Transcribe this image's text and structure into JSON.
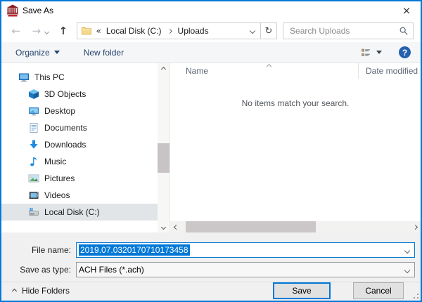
{
  "window": {
    "title": "Save As",
    "close_icon": "×"
  },
  "nav": {
    "back_icon": "←",
    "forward_icon": "→",
    "up_icon": "↑",
    "refresh_icon": "↻"
  },
  "address": {
    "prefix": "«",
    "crumbs": [
      "Local Disk (C:)",
      "Uploads"
    ]
  },
  "search": {
    "placeholder": "Search Uploads"
  },
  "toolbar": {
    "organize_label": "Organize",
    "new_folder_label": "New folder",
    "help_glyph": "?"
  },
  "sidebar": {
    "items": [
      {
        "label": "This PC",
        "icon": "this-pc-monitor"
      },
      {
        "label": "3D Objects",
        "icon": "3d-cube"
      },
      {
        "label": "Desktop",
        "icon": "desktop-monitor"
      },
      {
        "label": "Documents",
        "icon": "document"
      },
      {
        "label": "Downloads",
        "icon": "download-arrow"
      },
      {
        "label": "Music",
        "icon": "music-note"
      },
      {
        "label": "Pictures",
        "icon": "picture"
      },
      {
        "label": "Videos",
        "icon": "film-strip"
      },
      {
        "label": "Local Disk (C:)",
        "icon": "hard-drive",
        "selected": true
      }
    ]
  },
  "filelist": {
    "columns": [
      "Name",
      "Date modified"
    ],
    "empty_message": "No items match your search."
  },
  "fields": {
    "file_name_label": "File name:",
    "file_name_value": "2019.07.0320170710173458",
    "save_type_label": "Save as type:",
    "save_type_value": "ACH Files (*.ach)"
  },
  "footer": {
    "hide_folders_label": "Hide Folders",
    "save_label": "Save",
    "cancel_label": "Cancel"
  },
  "colors": {
    "window_border": "#0079d8",
    "selection_blue": "#0078d7",
    "toolbar_text": "#24446e",
    "help_circle": "#2461ad",
    "sidebar_selected_bg": "#e1e5e8",
    "footer_bg": "#f0f0f0",
    "title_icon_maroon": "#8b1b1f"
  }
}
